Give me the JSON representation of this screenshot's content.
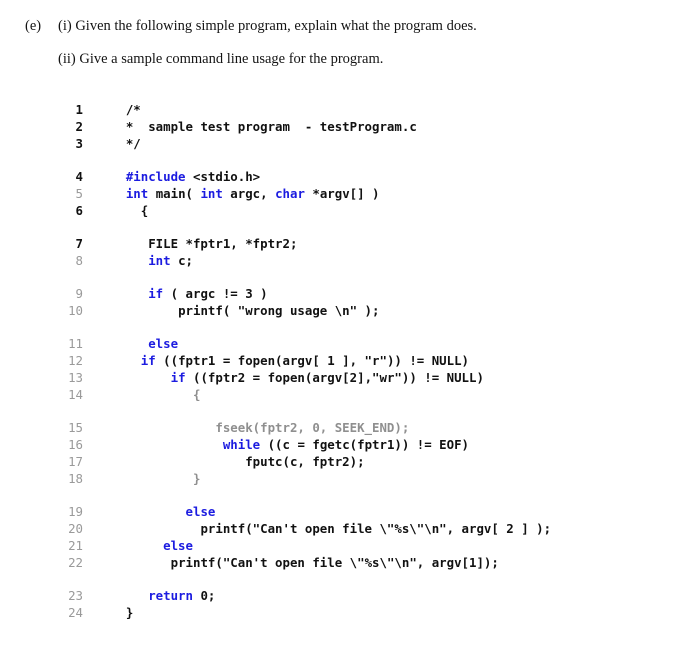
{
  "question": {
    "part_label": "(e)",
    "items": [
      {
        "marker": "(i)",
        "text": "Given the following simple program, explain what the program does."
      },
      {
        "marker": "(ii)",
        "text": "Give a sample command line usage for the program."
      }
    ]
  },
  "colors": {
    "background": "#ffffff",
    "text": "#111111",
    "keyword_blue": "#1c1ce0",
    "dim_gray": "#8f8f8f",
    "line_number_gray": "#9a9a9a",
    "line_number_bold": "#111111"
  },
  "code": {
    "language": "c",
    "filename": "testProgram.c",
    "lines": [
      {
        "n": "1",
        "bold_number": true,
        "gap_before": false,
        "indent": 4,
        "dim": false,
        "tokens": [
          {
            "t": "/*",
            "c": "plain"
          }
        ]
      },
      {
        "n": "2",
        "bold_number": true,
        "gap_before": false,
        "indent": 4,
        "dim": false,
        "tokens": [
          {
            "t": "*  sample test program  - testProgram.c",
            "c": "plain"
          }
        ]
      },
      {
        "n": "3",
        "bold_number": true,
        "gap_before": false,
        "indent": 4,
        "dim": false,
        "tokens": [
          {
            "t": "*/",
            "c": "plain"
          }
        ]
      },
      {
        "n": "4",
        "bold_number": true,
        "gap_before": true,
        "indent": 4,
        "dim": false,
        "tokens": [
          {
            "t": "#include",
            "c": "kw"
          },
          {
            "t": " <stdio.h>",
            "c": "plain"
          }
        ]
      },
      {
        "n": "5",
        "bold_number": false,
        "gap_before": false,
        "indent": 4,
        "dim": false,
        "tokens": [
          {
            "t": "int",
            "c": "kw"
          },
          {
            "t": " main( ",
            "c": "plain"
          },
          {
            "t": "int",
            "c": "kw"
          },
          {
            "t": " argc, ",
            "c": "plain"
          },
          {
            "t": "char",
            "c": "kw"
          },
          {
            "t": " *argv[] )",
            "c": "plain"
          }
        ]
      },
      {
        "n": "6",
        "bold_number": true,
        "gap_before": false,
        "indent": 6,
        "dim": false,
        "tokens": [
          {
            "t": "{",
            "c": "plain"
          }
        ]
      },
      {
        "n": "7",
        "bold_number": true,
        "gap_before": true,
        "indent": 7,
        "dim": false,
        "tokens": [
          {
            "t": "FILE *fptr1, *fptr2;",
            "c": "plain"
          }
        ]
      },
      {
        "n": "8",
        "bold_number": false,
        "gap_before": false,
        "indent": 7,
        "dim": false,
        "tokens": [
          {
            "t": "int",
            "c": "kw"
          },
          {
            "t": " c;",
            "c": "plain"
          }
        ]
      },
      {
        "n": "9",
        "bold_number": false,
        "gap_before": true,
        "indent": 7,
        "dim": false,
        "tokens": [
          {
            "t": "if",
            "c": "kw"
          },
          {
            "t": " ( argc != 3 )",
            "c": "plain"
          }
        ]
      },
      {
        "n": "10",
        "bold_number": false,
        "gap_before": false,
        "indent": 11,
        "dim": false,
        "tokens": [
          {
            "t": "printf( \"wrong usage \\n\" );",
            "c": "plain"
          }
        ]
      },
      {
        "n": "11",
        "bold_number": false,
        "gap_before": true,
        "indent": 7,
        "dim": false,
        "tokens": [
          {
            "t": "else",
            "c": "kw"
          }
        ]
      },
      {
        "n": "12",
        "bold_number": false,
        "gap_before": false,
        "indent": 6,
        "dim": false,
        "tokens": [
          {
            "t": "if",
            "c": "kw"
          },
          {
            "t": " ((fptr1 = fopen(argv[ 1 ], \"r\")) != NULL)",
            "c": "plain"
          }
        ]
      },
      {
        "n": "13",
        "bold_number": false,
        "gap_before": false,
        "indent": 10,
        "dim": false,
        "tokens": [
          {
            "t": "if",
            "c": "kw"
          },
          {
            "t": " ((fptr2 = fopen(argv[2],\"wr\")) != NULL)",
            "c": "plain"
          }
        ]
      },
      {
        "n": "14",
        "bold_number": false,
        "gap_before": false,
        "indent": 13,
        "dim": true,
        "tokens": [
          {
            "t": "{",
            "c": "plain"
          }
        ]
      },
      {
        "n": "15",
        "bold_number": false,
        "gap_before": true,
        "indent": 16,
        "dim": true,
        "tokens": [
          {
            "t": "fseek(fptr2, 0, SEEK_END);",
            "c": "plain"
          }
        ]
      },
      {
        "n": "16",
        "bold_number": false,
        "gap_before": false,
        "indent": 17,
        "dim": false,
        "tokens": [
          {
            "t": "while",
            "c": "kw"
          },
          {
            "t": " ((c = fgetc(fptr1)) != EOF)",
            "c": "plain"
          }
        ]
      },
      {
        "n": "17",
        "bold_number": false,
        "gap_before": false,
        "indent": 20,
        "dim": false,
        "tokens": [
          {
            "t": "fputc(c, fptr2);",
            "c": "plain"
          }
        ]
      },
      {
        "n": "18",
        "bold_number": false,
        "gap_before": false,
        "indent": 13,
        "dim": true,
        "tokens": [
          {
            "t": "}",
            "c": "plain"
          }
        ]
      },
      {
        "n": "19",
        "bold_number": false,
        "gap_before": true,
        "indent": 12,
        "dim": false,
        "tokens": [
          {
            "t": "else",
            "c": "kw"
          }
        ]
      },
      {
        "n": "20",
        "bold_number": false,
        "gap_before": false,
        "indent": 14,
        "dim": false,
        "tokens": [
          {
            "t": "printf(\"Can't open file \\\"%s\\\"\\n\", argv[ 2 ] );",
            "c": "plain"
          }
        ]
      },
      {
        "n": "21",
        "bold_number": false,
        "gap_before": false,
        "indent": 9,
        "dim": false,
        "tokens": [
          {
            "t": "else",
            "c": "kw"
          }
        ]
      },
      {
        "n": "22",
        "bold_number": false,
        "gap_before": false,
        "indent": 10,
        "dim": false,
        "tokens": [
          {
            "t": "printf(\"Can't open file \\\"%s\\\"\\n\", argv[1]);",
            "c": "plain"
          }
        ]
      },
      {
        "n": "23",
        "bold_number": false,
        "gap_before": true,
        "indent": 7,
        "dim": false,
        "tokens": [
          {
            "t": "return",
            "c": "kw"
          },
          {
            "t": " 0;",
            "c": "plain"
          }
        ]
      },
      {
        "n": "24",
        "bold_number": false,
        "gap_before": false,
        "indent": 4,
        "dim": false,
        "tokens": [
          {
            "t": "}",
            "c": "plain"
          }
        ]
      }
    ]
  }
}
